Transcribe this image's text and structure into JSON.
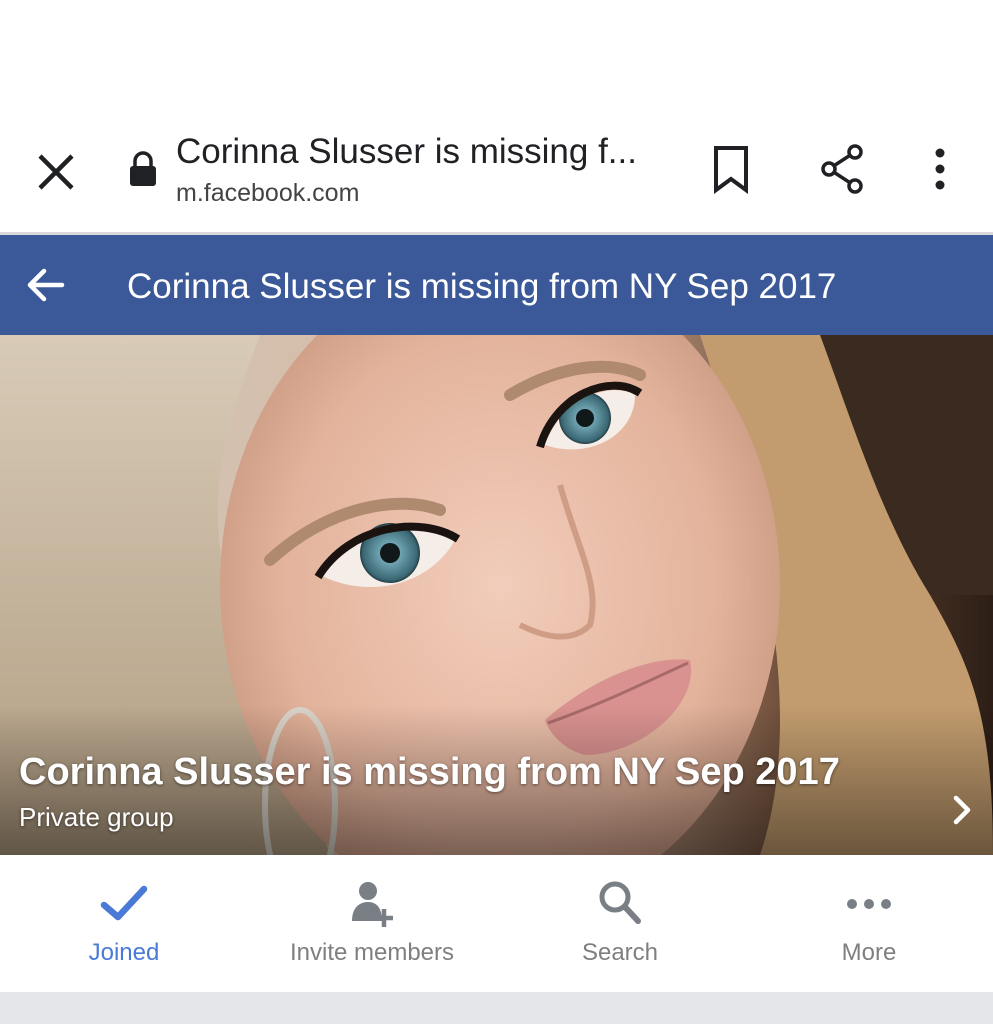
{
  "browser": {
    "tab_title": "Corinna Slusser is missing f...",
    "url": "m.facebook.com",
    "icons": {
      "close": "close-icon",
      "lock": "lock-icon",
      "bookmark": "bookmark-icon",
      "share": "share-icon",
      "menu": "more-vert-icon"
    }
  },
  "header": {
    "title": "Corinna Slusser is missing from NY Sep 2017",
    "back_icon": "arrow-left-icon",
    "background_color": "#3b5998"
  },
  "cover": {
    "group_name": "Corinna Slusser is missing from NY Sep 2017",
    "privacy": "Private group",
    "chevron_icon": "chevron-right-icon"
  },
  "actions": [
    {
      "label": "Joined",
      "icon": "check-icon",
      "active": true,
      "color": "#4a7ad6"
    },
    {
      "label": "Invite members",
      "icon": "add-person-icon",
      "active": false
    },
    {
      "label": "Search",
      "icon": "search-icon",
      "active": false
    },
    {
      "label": "More",
      "icon": "more-horiz-icon",
      "active": false
    }
  ]
}
